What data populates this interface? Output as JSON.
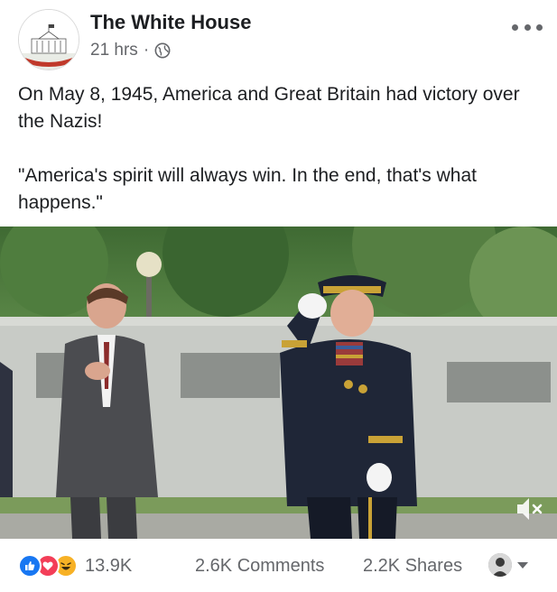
{
  "post": {
    "page_name": "The White House",
    "timestamp": "21 hrs",
    "separator": "·",
    "audience_icon": "globe-icon",
    "more_icon": "more-horizontal-icon",
    "text_lines": [
      "On May 8, 1945, America and Great Britain had victory over the Nazis!",
      "\"America's spirit will always win. In the end, that's what happens.\""
    ],
    "media": {
      "type": "video",
      "mute_icon": "speaker-muted-icon"
    },
    "footer": {
      "reaction_icons": [
        "like-icon",
        "love-icon",
        "haha-icon"
      ],
      "reaction_count": "13.9K",
      "comments": "2.6K Comments",
      "shares": "2.2K Shares"
    }
  },
  "colors": {
    "text": "#1c1e21",
    "secondary_text": "#65676b",
    "like": "#1877f2",
    "love": "#f33e58",
    "haha": "#f7b125"
  }
}
